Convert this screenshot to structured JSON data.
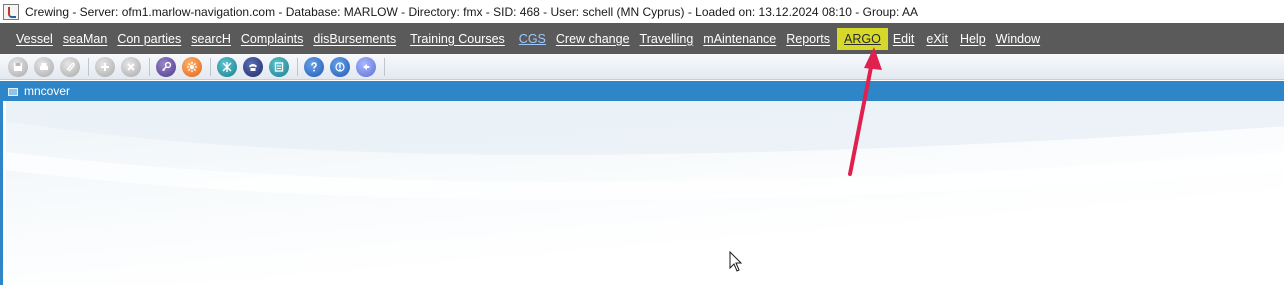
{
  "window": {
    "title": "Crewing - Server: ofm1.marlow-navigation.com - Database: MARLOW - Directory: fmx - SID: 468 - User: schell (MN Cyprus) - Loaded on: 13.12.2024 08:10 - Group: AA",
    "app_icon": "java-cup-icon"
  },
  "menubar": {
    "items": [
      {
        "label": "Vessel"
      },
      {
        "label": "seaMan"
      },
      {
        "label": "Con parties"
      },
      {
        "label": "searcH"
      },
      {
        "label": "Complaints"
      },
      {
        "label": "disBursements"
      },
      {
        "label": "Training Courses"
      },
      {
        "label": "CGS"
      },
      {
        "label": "Crew change"
      },
      {
        "label": "Travelling"
      },
      {
        "label": "mAintenance"
      },
      {
        "label": "Reports"
      },
      {
        "label": "ARGO"
      },
      {
        "label": "Edit"
      },
      {
        "label": "eXit"
      },
      {
        "label": "Help"
      },
      {
        "label": "Window"
      }
    ],
    "highlight_color": "#d7d92a"
  },
  "toolbar": {
    "buttons": [
      {
        "icon": "save-icon"
      },
      {
        "icon": "print-icon"
      },
      {
        "icon": "attach-icon"
      },
      {
        "icon": "add-icon"
      },
      {
        "icon": "delete-icon"
      },
      {
        "icon": "key-icon"
      },
      {
        "icon": "settings-icon"
      },
      {
        "icon": "tools-icon"
      },
      {
        "icon": "phone-icon"
      },
      {
        "icon": "calculator-icon"
      },
      {
        "icon": "help-icon"
      },
      {
        "icon": "info-icon"
      },
      {
        "icon": "back-icon"
      }
    ]
  },
  "frame": {
    "title": "mncover",
    "title_color": "#2e86c8"
  },
  "annotation": {
    "arrow_color": "#e0204f"
  }
}
